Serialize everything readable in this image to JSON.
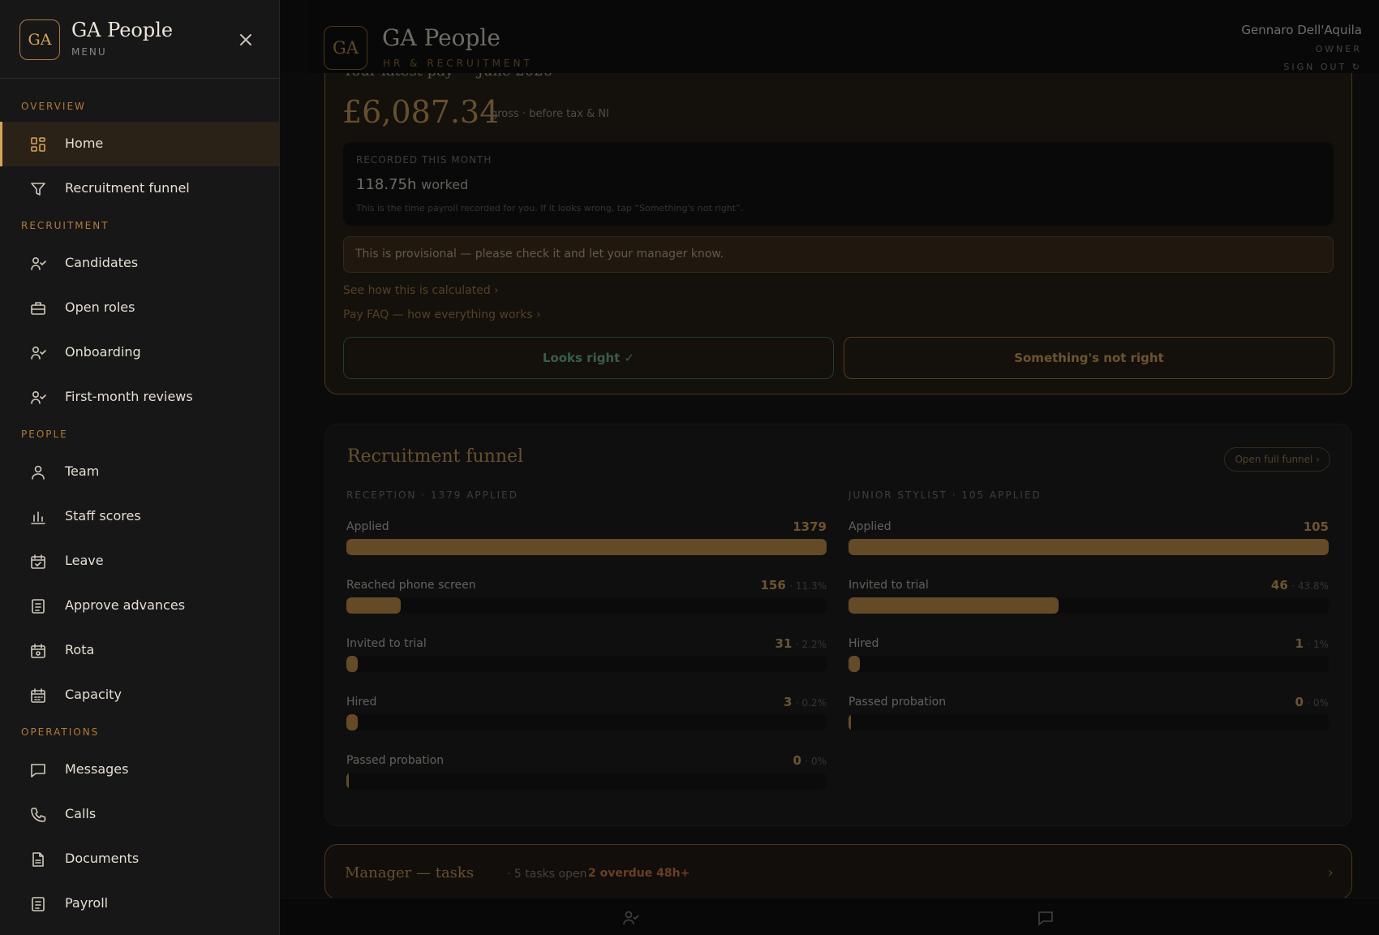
{
  "app": {
    "brand": "GA People",
    "monogram": "GA",
    "subtitle": "HR & RECRUITMENT"
  },
  "user": {
    "name": "Gennaro Dell'Aquila",
    "role": "OWNER",
    "sign_out": "SIGN OUT ↻"
  },
  "pay": {
    "heading": "Your latest pay — June 2026",
    "amount": "£6,087.34",
    "amount_note": "gross · before tax & NI",
    "recorded_label": "RECORDED THIS MONTH",
    "hours": "118.75h",
    "hours_unit": "worked",
    "recorded_help": "This is the time payroll recorded for you. If it looks wrong, tap “Something's not right”.",
    "provisional": "This is provisional — please check it and let your manager know.",
    "link_calc": "See how this is calculated ›",
    "link_faq": "Pay FAQ — how everything works ›",
    "btn_ok": "Looks right ✓",
    "btn_bad": "Something's not right"
  },
  "funnel": {
    "title": "Recruitment funnel",
    "open_label": "Open full funnel ›",
    "columns": [
      {
        "heading": "RECEPTION · 1379 APPLIED",
        "stages": [
          {
            "label": "Applied",
            "count": "1379",
            "pct": "",
            "fraction": 1.0
          },
          {
            "label": "Reached phone screen",
            "count": "156",
            "pct": "· 11.3%",
            "fraction": 0.113
          },
          {
            "label": "Invited to trial",
            "count": "31",
            "pct": "· 2.2%",
            "fraction": 0.022
          },
          {
            "label": "Hired",
            "count": "3",
            "pct": "· 0.2%",
            "fraction": 0.002
          },
          {
            "label": "Passed probation",
            "count": "0",
            "pct": "· 0%",
            "fraction": 0.0
          }
        ]
      },
      {
        "heading": "JUNIOR STYLIST · 105 APPLIED",
        "stages": [
          {
            "label": "Applied",
            "count": "105",
            "pct": "",
            "fraction": 1.0
          },
          {
            "label": "Invited to trial",
            "count": "46",
            "pct": "· 43.8%",
            "fraction": 0.438
          },
          {
            "label": "Hired",
            "count": "1",
            "pct": "· 1%",
            "fraction": 0.01
          },
          {
            "label": "Passed probation",
            "count": "0",
            "pct": "· 0%",
            "fraction": 0.0
          }
        ]
      }
    ]
  },
  "tasks": {
    "title": "Manager — tasks",
    "open": "· 5 tasks open ·",
    "overdue": "2 overdue 48h+",
    "chevron": "›"
  },
  "sidebar": {
    "brand": "GA People",
    "monogram": "GA",
    "sub": "MENU",
    "sections": [
      {
        "title": "OVERVIEW",
        "items": [
          {
            "label": "Home",
            "icon": "grid-icon",
            "active": true
          },
          {
            "label": "Recruitment funnel",
            "icon": "filter-icon"
          }
        ]
      },
      {
        "title": "RECRUITMENT",
        "items": [
          {
            "label": "Candidates",
            "icon": "user-check-icon"
          },
          {
            "label": "Open roles",
            "icon": "briefcase-icon"
          },
          {
            "label": "Onboarding",
            "icon": "user-check-icon"
          },
          {
            "label": "First-month reviews",
            "icon": "user-check-icon"
          }
        ]
      },
      {
        "title": "PEOPLE",
        "items": [
          {
            "label": "Team",
            "icon": "user-icon"
          },
          {
            "label": "Staff scores",
            "icon": "bar-chart-icon"
          },
          {
            "label": "Leave",
            "icon": "calendar-check-icon"
          },
          {
            "label": "Approve advances",
            "icon": "document-icon"
          },
          {
            "label": "Rota",
            "icon": "calendar-icon"
          },
          {
            "label": "Capacity",
            "icon": "calendar-grid-icon"
          }
        ]
      },
      {
        "title": "OPERATIONS",
        "items": [
          {
            "label": "Messages",
            "icon": "message-icon"
          },
          {
            "label": "Calls",
            "icon": "phone-icon"
          },
          {
            "label": "Documents",
            "icon": "file-icon"
          },
          {
            "label": "Payroll",
            "icon": "document-icon"
          }
        ]
      }
    ]
  },
  "bottom_nav": [
    {
      "icon": "user-check-icon"
    },
    {
      "icon": "message-icon"
    }
  ]
}
